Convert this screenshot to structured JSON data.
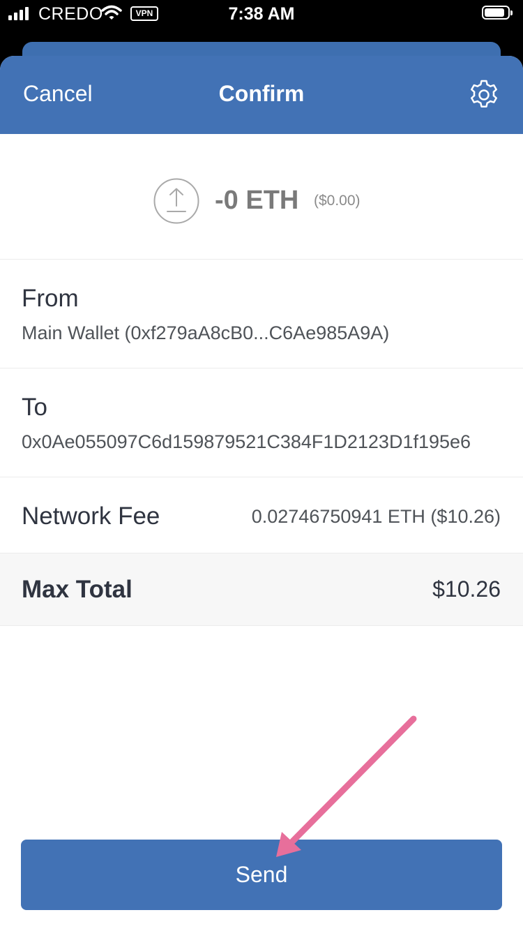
{
  "status_bar": {
    "carrier": "CREDO",
    "vpn_badge": "VPN",
    "time": "7:38 AM"
  },
  "nav": {
    "cancel_label": "Cancel",
    "title": "Confirm",
    "settings_icon": "gear-icon"
  },
  "transaction": {
    "amount": "-0 ETH",
    "amount_fiat": "($0.00)",
    "from_label": "From",
    "from_value": "Main Wallet (0xf279aA8cB0...C6Ae985A9A)",
    "to_label": "To",
    "to_value": "0x0Ae055097C6d159879521C384F1D2123D1f195e6",
    "network_fee_label": "Network Fee",
    "network_fee_value": "0.02746750941 ETH ($10.26)",
    "max_total_label": "Max Total",
    "max_total_value": "$10.26"
  },
  "actions": {
    "send_label": "Send"
  },
  "colors": {
    "primary": "#4272b5",
    "annotation_arrow": "#e76f9b"
  }
}
